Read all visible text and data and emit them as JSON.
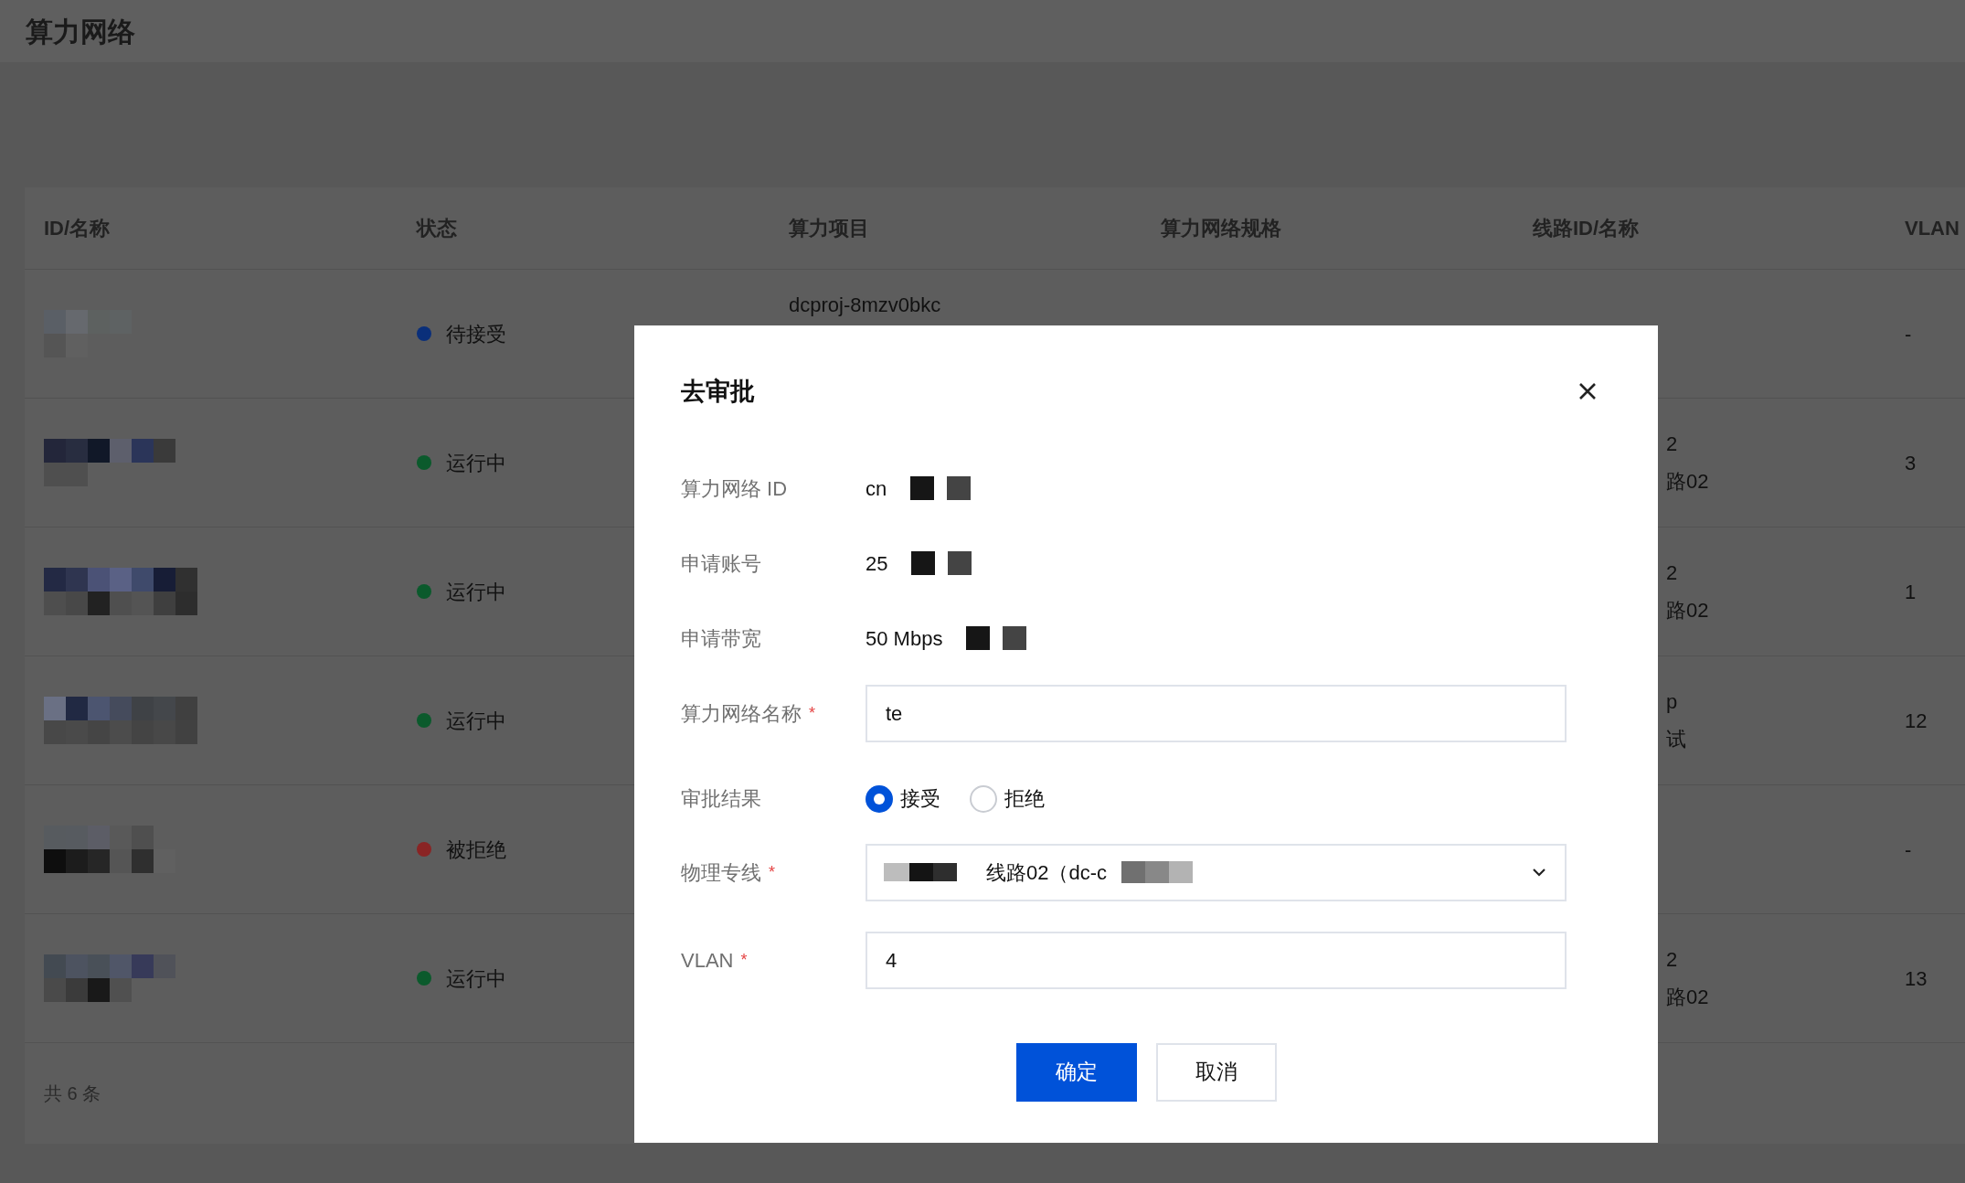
{
  "page": {
    "title": "算力网络"
  },
  "table": {
    "columns": [
      "ID/名称",
      "状态",
      "算力项目",
      "算力网络规格",
      "线路ID/名称",
      "VLAN"
    ],
    "rows": [
      {
        "status": "待接受",
        "color": "#0a2f7a",
        "project": "dcproj-8mzv0bkc",
        "line": [],
        "vlan": "-"
      },
      {
        "status": "运行中",
        "color": "#0b5a2c",
        "line": [
          "2",
          "路02"
        ],
        "vlan": "3"
      },
      {
        "status": "运行中",
        "color": "#0b5a2c",
        "line": [
          "2",
          "路02"
        ],
        "vlan": "1"
      },
      {
        "status": "运行中",
        "color": "#0b5a2c",
        "line": [
          "p",
          "试"
        ],
        "vlan": "12"
      },
      {
        "status": "被拒绝",
        "color": "#8a2424",
        "line": [],
        "vlan": "-"
      },
      {
        "status": "运行中",
        "color": "#0b5a2c",
        "line": [
          "2",
          "路02"
        ],
        "vlan": "13"
      }
    ],
    "footer": "共 6 条"
  },
  "dialog": {
    "title": "去审批",
    "required_mark": "*",
    "fields": [
      {
        "kind": "text",
        "label": "算力网络 ID",
        "value": "cn",
        "required": false
      },
      {
        "kind": "text",
        "label": "申请账号",
        "value": "25",
        "required": false
      },
      {
        "kind": "text",
        "label": "申请带宽",
        "value": "50 Mbps",
        "required": false
      },
      {
        "kind": "input",
        "label": "算力网络名称",
        "value": "te",
        "required": true
      },
      {
        "kind": "radio",
        "label": "审批结果",
        "required": false,
        "options": [
          {
            "label": "接受",
            "selected": true
          },
          {
            "label": "拒绝",
            "selected": false
          }
        ]
      },
      {
        "kind": "select",
        "label": "物理专线",
        "value": "线路02（dc-c",
        "required": true
      },
      {
        "kind": "input",
        "label": "VLAN",
        "value": "4",
        "required": true
      }
    ],
    "buttons": [
      {
        "label": "确定",
        "kind": "primary"
      },
      {
        "label": "取消",
        "kind": "default"
      }
    ]
  }
}
